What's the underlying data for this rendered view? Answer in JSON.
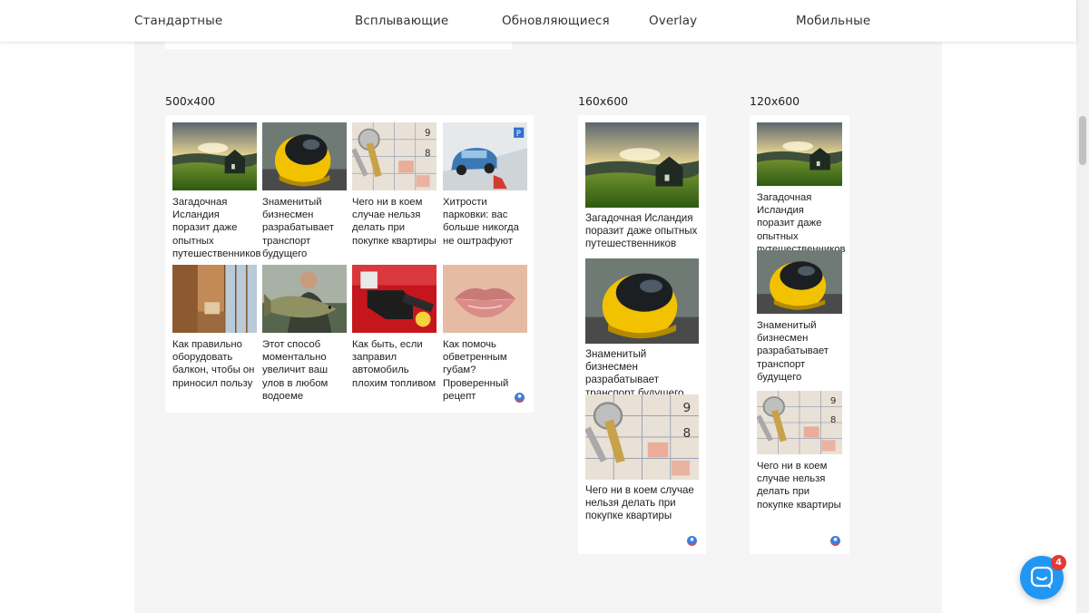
{
  "nav": {
    "items": [
      "Стандартные",
      "Всплывающие",
      "Обновляющиеся",
      "Overlay",
      "Мобильные"
    ]
  },
  "widgets": {
    "w500": {
      "label": "500x400"
    },
    "w160": {
      "label": "160x600"
    },
    "w120": {
      "label": "120x600"
    }
  },
  "captions": {
    "iceland": "Загадочная Исландия поразит даже опытных путешественников",
    "transport": "Знаменитый бизнесмен разрабатывает транспорт будущего",
    "keys": "Чего ни в коем случае нельзя делать при покупке квартиры",
    "parking": "Хитрости парковки: вас больше никогда не оштрафуют",
    "balcony": "Как правильно оборудовать балкон, чтобы он приносил пользу",
    "fish": "Этот способ моментально увеличит ваш улов в любом водоеме",
    "fuel": "Как быть, если заправил автомобиль плохим топливом",
    "lips": "Как помочь обветренным губам? Проверенный рецепт"
  },
  "chat": {
    "count": "4"
  },
  "colors": {
    "accent": "#2196f3",
    "badge": "#e53935",
    "background": "#f5f5f5"
  },
  "icons": {
    "chat": "chat-bubble-icon",
    "brand": "widget-logo-icon"
  }
}
